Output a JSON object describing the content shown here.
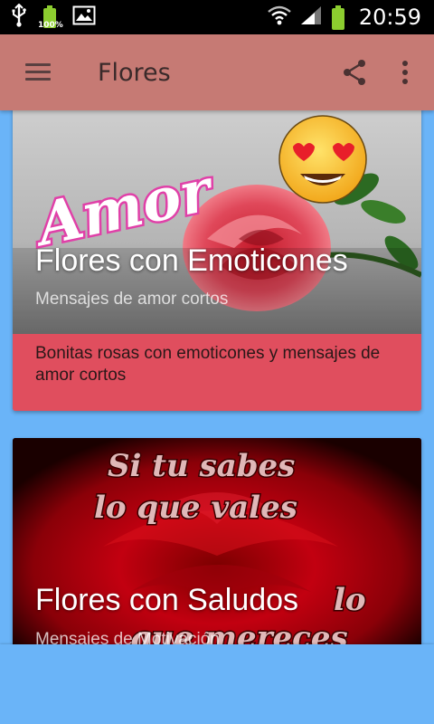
{
  "status_bar": {
    "time": "20:59",
    "battery_small_pct": "100%"
  },
  "toolbar": {
    "title": "Flores"
  },
  "cards": [
    {
      "title": "Flores con Emoticones",
      "subtitle": "Mensajes de amor cortos",
      "description": "Bonitas rosas con emoticones y mensajes de amor cortos",
      "image_text": "Amor"
    },
    {
      "title": "Flores con Saludos",
      "subtitle": "Mensajes de Motivación",
      "image_text_line1": "Si tu sabes",
      "image_text_line2": "lo que vales",
      "image_text_line3": "lo",
      "image_text_line4": "que mereces"
    }
  ],
  "colors": {
    "toolbar_bg": "#c67a74",
    "card_accent": "#e04e5e",
    "page_bg": "#6ab4f8"
  }
}
